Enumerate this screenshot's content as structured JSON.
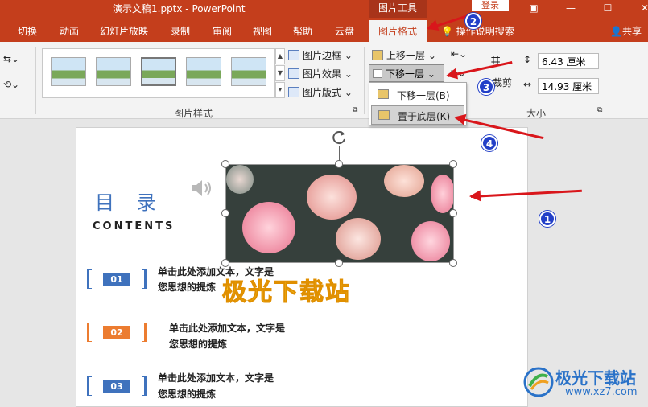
{
  "titlebar": {
    "title": "演示文稿1.pptx  -  PowerPoint",
    "context_tool": "图片工具",
    "login": "登录",
    "colors": {
      "bg": "#c43e1c"
    }
  },
  "tabs": {
    "items": [
      "切换",
      "动画",
      "幻灯片放映",
      "录制",
      "审阅",
      "视图",
      "帮助",
      "云盘"
    ],
    "active": "图片格式",
    "search": "操作说明搜索",
    "share": "共享"
  },
  "ribbon": {
    "picture_border": "图片边框",
    "picture_effect": "图片效果",
    "picture_layout": "图片版式",
    "styles_group_label": "图片样式",
    "bring_forward": "上移一层",
    "send_backward": "下移一层",
    "crop": "裁剪",
    "height": "6.43 厘米",
    "width": "14.93 厘米",
    "size_group_label": "大小"
  },
  "dropdown": {
    "items": [
      "下移一层(B)",
      "置于底层(K)"
    ]
  },
  "slide": {
    "toc_title": "目 录",
    "toc_sub": "CONTENTS",
    "items": [
      {
        "num": "01",
        "line1": "单击此处添加文本，文字是",
        "line2": "您思想的提炼",
        "color": "#3f72bd"
      },
      {
        "num": "02",
        "line1": "单击此处添加文本，文字是",
        "line2": "您思想的提炼",
        "color": "#ec7c30"
      },
      {
        "num": "03",
        "line1": "单击此处添加文本，文字是",
        "line2": "您思想的提炼",
        "color": "#3f72bd"
      }
    ],
    "overlay_text": "极光下载站"
  },
  "annotations": {
    "badges": [
      "1",
      "2",
      "3",
      "4"
    ],
    "arrow_color": "#d9161b"
  },
  "brand": {
    "name": "极光下载站",
    "url": "www.xz7.com"
  }
}
